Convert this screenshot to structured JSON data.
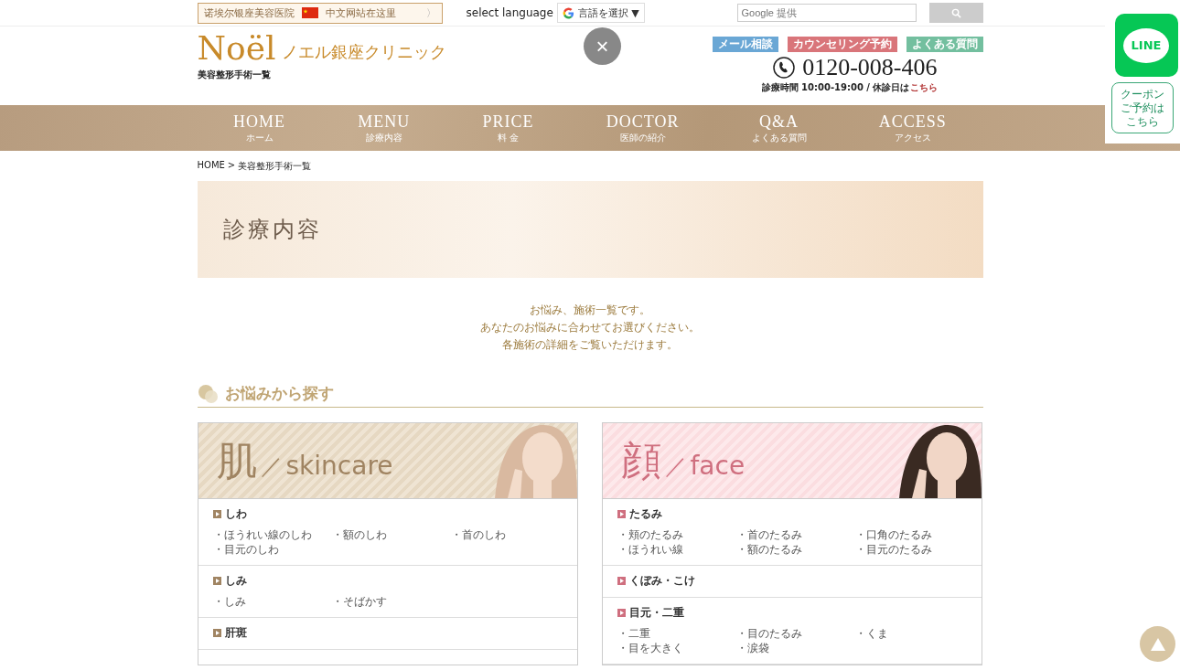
{
  "top_bar": {
    "china_link": {
      "label": "诺埃尔银座美容医院",
      "link": "中文网站在这里",
      "arrow": "〉"
    },
    "language_label": "select language",
    "translate_select": {
      "value": "言語を選択",
      "caret": "▼"
    },
    "search": {
      "placeholder": "Google 提供"
    }
  },
  "overlay_close": "×",
  "header": {
    "logo": "Noël",
    "clinic_name": "ノエル銀座クリニック",
    "subtitle": "美容整形手術一覧",
    "buttons": [
      {
        "label": "メール相談",
        "color": "#6aa7d5"
      },
      {
        "label": "カウンセリング予約",
        "color": "#d9757a"
      },
      {
        "label": "よくある質問",
        "color": "#73bf9f"
      }
    ],
    "phone": "0120-008-406",
    "hours": "診療時間 10:00-19:00 / 休診日は",
    "hours_link": "こちら"
  },
  "nav": [
    {
      "en": "HOME",
      "ja": "ホーム"
    },
    {
      "en": "MENU",
      "ja": "診療内容"
    },
    {
      "en": "PRICE",
      "ja": "料 金"
    },
    {
      "en": "DOCTOR",
      "ja": "医師の紹介"
    },
    {
      "en": "Q&A",
      "ja": "よくある質問"
    },
    {
      "en": "ACCESS",
      "ja": "アクセス"
    }
  ],
  "breadcrumb": [
    {
      "label": "HOME"
    },
    {
      "label": "美容整形手術一覧"
    }
  ],
  "breadcrumb_sep": ">",
  "banner_title": "診療内容",
  "intro": [
    "お悩み、施術一覧です。",
    "あなたのお悩みに合わせてお選びください。",
    "各施術の詳細をご覧いただけます。"
  ],
  "section_title": "お悩みから探す",
  "cards": [
    {
      "kind": "skin",
      "color": "#a08462",
      "kanji": "肌",
      "slash": "／",
      "english": "skincare",
      "groups": [
        {
          "title": "しわ",
          "items": [
            "・ほうれい線のしわ",
            "・額のしわ",
            "・首のしわ",
            "・目元のしわ"
          ]
        },
        {
          "title": "しみ",
          "items": [
            "・しみ",
            "・そばかす"
          ]
        },
        {
          "title": "肝斑"
        }
      ]
    },
    {
      "kind": "face",
      "color": "#cf6f7f",
      "kanji": "顔",
      "slash": "／",
      "english": "face",
      "groups": [
        {
          "title": "たるみ",
          "items": [
            "・頬のたるみ",
            "・首のたるみ",
            "・口角のたるみ",
            "・ほうれい線",
            "・額のたるみ",
            "・目元のたるみ"
          ]
        },
        {
          "title": "くぼみ・こけ"
        },
        {
          "title": "目元・二重",
          "items": [
            "・二重",
            "・目のたるみ",
            "・くま",
            "・目を大きく",
            "・涙袋"
          ]
        }
      ]
    }
  ],
  "side": {
    "line": "LINE",
    "coupon": [
      "クーポン",
      "ご予約は",
      "こちら"
    ]
  }
}
